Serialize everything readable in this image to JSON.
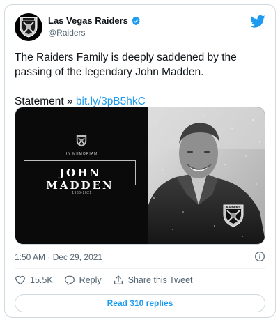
{
  "account": {
    "display_name": "Las Vegas Raiders",
    "handle": "@Raiders",
    "logo_wordmark": "RAIDERS"
  },
  "tweet": {
    "text_line1": "The Raiders Family is deeply saddened by the passing of the legendary John Madden.",
    "statement_prefix": "Statement » ",
    "statement_link": "bit.ly/3pB5hkC"
  },
  "media": {
    "in_memoriam": "IN MEMORIAM",
    "name": "JOHN MADDEN",
    "years": "1936-2021",
    "jacket_wordmark": "RAIDERS"
  },
  "meta": {
    "time": "1:50 AM",
    "separator": " · ",
    "date": "Dec 29, 2021"
  },
  "actions": {
    "likes": "15.5K",
    "reply": "Reply",
    "share": "Share this Tweet"
  },
  "read_replies": "Read 310 replies",
  "colors": {
    "accent": "#1d9bf0",
    "secondary_text": "#536471",
    "border": "#cfd9de"
  }
}
